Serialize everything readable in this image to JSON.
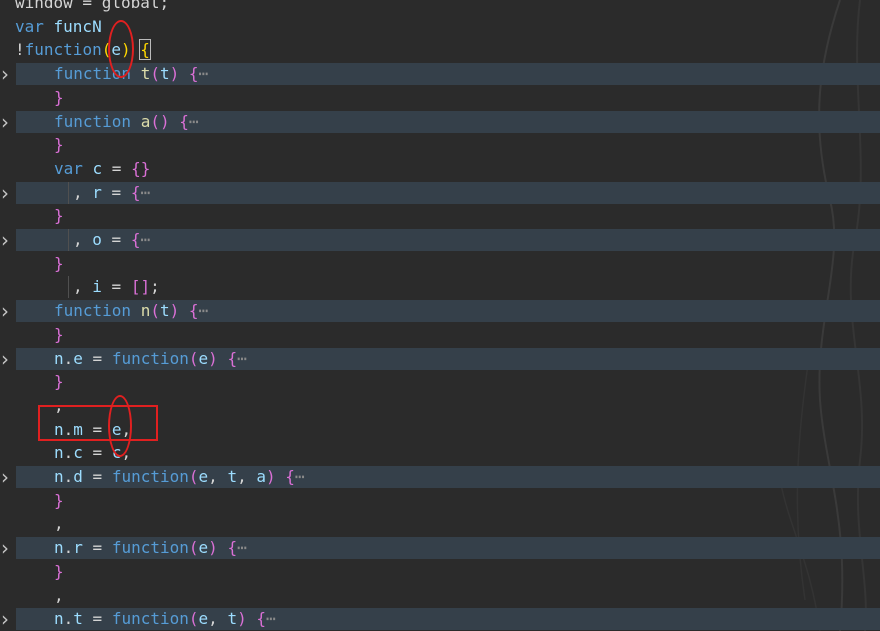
{
  "editor": {
    "lines": [
      {
        "id": "l0",
        "indent": 0,
        "fold": false,
        "parts": [
          {
            "t": "window = global;",
            "c": "punc"
          }
        ]
      },
      {
        "id": "l1",
        "indent": 0,
        "fold": false,
        "parts": [
          {
            "t": "var ",
            "c": "kw"
          },
          {
            "t": "funcN",
            "c": "var"
          }
        ]
      },
      {
        "id": "l2",
        "indent": 0,
        "fold": false,
        "parts": [
          {
            "t": "!",
            "c": "punc"
          },
          {
            "t": "function",
            "c": "kw"
          },
          {
            "t": "(",
            "c": "br3"
          },
          {
            "t": "e",
            "c": "var"
          },
          {
            "t": ")",
            "c": "br3"
          },
          {
            "t": " ",
            "c": "punc"
          },
          {
            "t": "{",
            "c": "br3"
          }
        ]
      },
      {
        "id": "l3",
        "indent": 1,
        "fold": true,
        "parts": [
          {
            "t": "function ",
            "c": "kw"
          },
          {
            "t": "t",
            "c": "fn"
          },
          {
            "t": "(",
            "c": "br"
          },
          {
            "t": "t",
            "c": "var"
          },
          {
            "t": ")",
            "c": "br"
          },
          {
            "t": " ",
            "c": "punc"
          },
          {
            "t": "{",
            "c": "br"
          },
          {
            "t": "⋯",
            "c": "ellipsis"
          }
        ]
      },
      {
        "id": "l4",
        "indent": 1,
        "fold": false,
        "parts": [
          {
            "t": "}",
            "c": "br"
          }
        ]
      },
      {
        "id": "l5",
        "indent": 1,
        "fold": true,
        "parts": [
          {
            "t": "function ",
            "c": "kw"
          },
          {
            "t": "a",
            "c": "fn"
          },
          {
            "t": "()",
            "c": "br"
          },
          {
            "t": " ",
            "c": "punc"
          },
          {
            "t": "{",
            "c": "br"
          },
          {
            "t": "⋯",
            "c": "ellipsis"
          }
        ]
      },
      {
        "id": "l6",
        "indent": 1,
        "fold": false,
        "parts": [
          {
            "t": "}",
            "c": "br"
          }
        ]
      },
      {
        "id": "l7",
        "indent": 1,
        "fold": false,
        "parts": [
          {
            "t": "var ",
            "c": "kw"
          },
          {
            "t": "c",
            "c": "var"
          },
          {
            "t": " = ",
            "c": "punc"
          },
          {
            "t": "{}",
            "c": "br"
          }
        ]
      },
      {
        "id": "l8",
        "indent": 2,
        "fold": true,
        "parts": [
          {
            "t": ", ",
            "c": "punc"
          },
          {
            "t": "r",
            "c": "var"
          },
          {
            "t": " = ",
            "c": "punc"
          },
          {
            "t": "{",
            "c": "br"
          },
          {
            "t": "⋯",
            "c": "ellipsis"
          }
        ]
      },
      {
        "id": "l9",
        "indent": 1,
        "fold": false,
        "parts": [
          {
            "t": "}",
            "c": "br"
          }
        ]
      },
      {
        "id": "l10",
        "indent": 2,
        "fold": true,
        "parts": [
          {
            "t": ", ",
            "c": "punc"
          },
          {
            "t": "o",
            "c": "var"
          },
          {
            "t": " = ",
            "c": "punc"
          },
          {
            "t": "{",
            "c": "br"
          },
          {
            "t": "⋯",
            "c": "ellipsis"
          }
        ]
      },
      {
        "id": "l11",
        "indent": 1,
        "fold": false,
        "parts": [
          {
            "t": "}",
            "c": "br"
          }
        ]
      },
      {
        "id": "l12",
        "indent": 2,
        "fold": false,
        "parts": [
          {
            "t": ", ",
            "c": "punc"
          },
          {
            "t": "i",
            "c": "var"
          },
          {
            "t": " = ",
            "c": "punc"
          },
          {
            "t": "[]",
            "c": "br"
          },
          {
            "t": ";",
            "c": "punc"
          }
        ]
      },
      {
        "id": "l13",
        "indent": 1,
        "fold": true,
        "parts": [
          {
            "t": "function ",
            "c": "kw"
          },
          {
            "t": "n",
            "c": "fn"
          },
          {
            "t": "(",
            "c": "br"
          },
          {
            "t": "t",
            "c": "var"
          },
          {
            "t": ")",
            "c": "br"
          },
          {
            "t": " ",
            "c": "punc"
          },
          {
            "t": "{",
            "c": "br"
          },
          {
            "t": "⋯",
            "c": "ellipsis"
          }
        ]
      },
      {
        "id": "l14",
        "indent": 1,
        "fold": false,
        "parts": [
          {
            "t": "}",
            "c": "br"
          }
        ]
      },
      {
        "id": "l15",
        "indent": 1,
        "fold": true,
        "parts": [
          {
            "t": "n",
            "c": "var"
          },
          {
            "t": ".",
            "c": "punc"
          },
          {
            "t": "e",
            "c": "var"
          },
          {
            "t": " = ",
            "c": "punc"
          },
          {
            "t": "function",
            "c": "kw"
          },
          {
            "t": "(",
            "c": "br"
          },
          {
            "t": "e",
            "c": "var"
          },
          {
            "t": ")",
            "c": "br"
          },
          {
            "t": " ",
            "c": "punc"
          },
          {
            "t": "{",
            "c": "br"
          },
          {
            "t": "⋯",
            "c": "ellipsis"
          }
        ]
      },
      {
        "id": "l16",
        "indent": 1,
        "fold": false,
        "parts": [
          {
            "t": "}",
            "c": "br"
          }
        ]
      },
      {
        "id": "l17",
        "indent": 1,
        "fold": false,
        "parts": [
          {
            "t": ",",
            "c": "punc"
          }
        ]
      },
      {
        "id": "l18",
        "indent": 1,
        "fold": false,
        "parts": [
          {
            "t": "n",
            "c": "var"
          },
          {
            "t": ".",
            "c": "punc"
          },
          {
            "t": "m",
            "c": "var"
          },
          {
            "t": " = ",
            "c": "punc"
          },
          {
            "t": "e",
            "c": "var"
          },
          {
            "t": ",",
            "c": "punc"
          }
        ]
      },
      {
        "id": "l19",
        "indent": 1,
        "fold": false,
        "parts": [
          {
            "t": "n",
            "c": "var"
          },
          {
            "t": ".",
            "c": "punc"
          },
          {
            "t": "c",
            "c": "var"
          },
          {
            "t": " = ",
            "c": "punc"
          },
          {
            "t": "c",
            "c": "var"
          },
          {
            "t": ",",
            "c": "punc"
          }
        ]
      },
      {
        "id": "l20",
        "indent": 1,
        "fold": true,
        "parts": [
          {
            "t": "n",
            "c": "var"
          },
          {
            "t": ".",
            "c": "punc"
          },
          {
            "t": "d",
            "c": "var"
          },
          {
            "t": " = ",
            "c": "punc"
          },
          {
            "t": "function",
            "c": "kw"
          },
          {
            "t": "(",
            "c": "br"
          },
          {
            "t": "e",
            "c": "var"
          },
          {
            "t": ", ",
            "c": "punc"
          },
          {
            "t": "t",
            "c": "var"
          },
          {
            "t": ", ",
            "c": "punc"
          },
          {
            "t": "a",
            "c": "var"
          },
          {
            "t": ")",
            "c": "br"
          },
          {
            "t": " ",
            "c": "punc"
          },
          {
            "t": "{",
            "c": "br"
          },
          {
            "t": "⋯",
            "c": "ellipsis"
          }
        ]
      },
      {
        "id": "l21",
        "indent": 1,
        "fold": false,
        "parts": [
          {
            "t": "}",
            "c": "br"
          }
        ]
      },
      {
        "id": "l22",
        "indent": 1,
        "fold": false,
        "parts": [
          {
            "t": ",",
            "c": "punc"
          }
        ]
      },
      {
        "id": "l23",
        "indent": 1,
        "fold": true,
        "parts": [
          {
            "t": "n",
            "c": "var"
          },
          {
            "t": ".",
            "c": "punc"
          },
          {
            "t": "r",
            "c": "var"
          },
          {
            "t": " = ",
            "c": "punc"
          },
          {
            "t": "function",
            "c": "kw"
          },
          {
            "t": "(",
            "c": "br"
          },
          {
            "t": "e",
            "c": "var"
          },
          {
            "t": ")",
            "c": "br"
          },
          {
            "t": " ",
            "c": "punc"
          },
          {
            "t": "{",
            "c": "br"
          },
          {
            "t": "⋯",
            "c": "ellipsis"
          }
        ]
      },
      {
        "id": "l24",
        "indent": 1,
        "fold": false,
        "parts": [
          {
            "t": "}",
            "c": "br"
          }
        ]
      },
      {
        "id": "l25",
        "indent": 1,
        "fold": false,
        "parts": [
          {
            "t": ",",
            "c": "punc"
          }
        ]
      },
      {
        "id": "l26",
        "indent": 1,
        "fold": true,
        "parts": [
          {
            "t": "n",
            "c": "var"
          },
          {
            "t": ".",
            "c": "punc"
          },
          {
            "t": "t",
            "c": "var"
          },
          {
            "t": " = ",
            "c": "punc"
          },
          {
            "t": "function",
            "c": "kw"
          },
          {
            "t": "(",
            "c": "br"
          },
          {
            "t": "e",
            "c": "var"
          },
          {
            "t": ", ",
            "c": "punc"
          },
          {
            "t": "t",
            "c": "var"
          },
          {
            "t": ")",
            "c": "br"
          },
          {
            "t": " ",
            "c": "punc"
          },
          {
            "t": "{",
            "c": "br"
          },
          {
            "t": "⋯",
            "c": "ellipsis"
          }
        ]
      },
      {
        "id": "l27",
        "indent": 1,
        "fold": false,
        "parts": [
          {
            "t": "}",
            "c": "br"
          }
        ]
      }
    ]
  },
  "colors": {
    "background": "#2b2b2b",
    "fold_highlight": "#35404a",
    "keyword": "#569cd6",
    "function_name": "#dcdcaa",
    "bracket": "#da70d6",
    "outer_bracket": "#ffd700",
    "variable": "#9cdcfe",
    "annotation": "#e02020"
  },
  "icons": {
    "fold": "chevron-right-icon"
  }
}
